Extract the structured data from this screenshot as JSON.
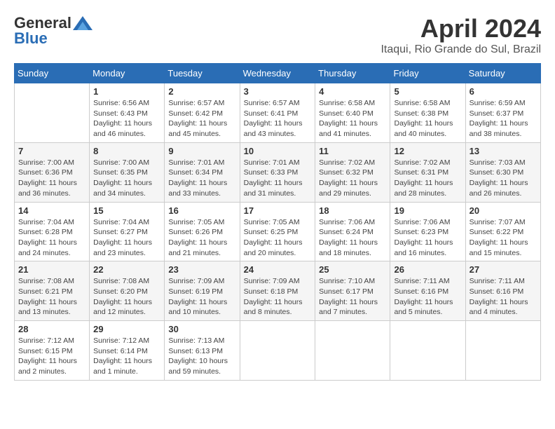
{
  "header": {
    "logo_general": "General",
    "logo_blue": "Blue",
    "month": "April 2024",
    "location": "Itaqui, Rio Grande do Sul, Brazil"
  },
  "weekdays": [
    "Sunday",
    "Monday",
    "Tuesday",
    "Wednesday",
    "Thursday",
    "Friday",
    "Saturday"
  ],
  "weeks": [
    [
      {
        "day": "",
        "sunrise": "",
        "sunset": "",
        "daylight": ""
      },
      {
        "day": "1",
        "sunrise": "Sunrise: 6:56 AM",
        "sunset": "Sunset: 6:43 PM",
        "daylight": "Daylight: 11 hours and 46 minutes."
      },
      {
        "day": "2",
        "sunrise": "Sunrise: 6:57 AM",
        "sunset": "Sunset: 6:42 PM",
        "daylight": "Daylight: 11 hours and 45 minutes."
      },
      {
        "day": "3",
        "sunrise": "Sunrise: 6:57 AM",
        "sunset": "Sunset: 6:41 PM",
        "daylight": "Daylight: 11 hours and 43 minutes."
      },
      {
        "day": "4",
        "sunrise": "Sunrise: 6:58 AM",
        "sunset": "Sunset: 6:40 PM",
        "daylight": "Daylight: 11 hours and 41 minutes."
      },
      {
        "day": "5",
        "sunrise": "Sunrise: 6:58 AM",
        "sunset": "Sunset: 6:38 PM",
        "daylight": "Daylight: 11 hours and 40 minutes."
      },
      {
        "day": "6",
        "sunrise": "Sunrise: 6:59 AM",
        "sunset": "Sunset: 6:37 PM",
        "daylight": "Daylight: 11 hours and 38 minutes."
      }
    ],
    [
      {
        "day": "7",
        "sunrise": "Sunrise: 7:00 AM",
        "sunset": "Sunset: 6:36 PM",
        "daylight": "Daylight: 11 hours and 36 minutes."
      },
      {
        "day": "8",
        "sunrise": "Sunrise: 7:00 AM",
        "sunset": "Sunset: 6:35 PM",
        "daylight": "Daylight: 11 hours and 34 minutes."
      },
      {
        "day": "9",
        "sunrise": "Sunrise: 7:01 AM",
        "sunset": "Sunset: 6:34 PM",
        "daylight": "Daylight: 11 hours and 33 minutes."
      },
      {
        "day": "10",
        "sunrise": "Sunrise: 7:01 AM",
        "sunset": "Sunset: 6:33 PM",
        "daylight": "Daylight: 11 hours and 31 minutes."
      },
      {
        "day": "11",
        "sunrise": "Sunrise: 7:02 AM",
        "sunset": "Sunset: 6:32 PM",
        "daylight": "Daylight: 11 hours and 29 minutes."
      },
      {
        "day": "12",
        "sunrise": "Sunrise: 7:02 AM",
        "sunset": "Sunset: 6:31 PM",
        "daylight": "Daylight: 11 hours and 28 minutes."
      },
      {
        "day": "13",
        "sunrise": "Sunrise: 7:03 AM",
        "sunset": "Sunset: 6:30 PM",
        "daylight": "Daylight: 11 hours and 26 minutes."
      }
    ],
    [
      {
        "day": "14",
        "sunrise": "Sunrise: 7:04 AM",
        "sunset": "Sunset: 6:28 PM",
        "daylight": "Daylight: 11 hours and 24 minutes."
      },
      {
        "day": "15",
        "sunrise": "Sunrise: 7:04 AM",
        "sunset": "Sunset: 6:27 PM",
        "daylight": "Daylight: 11 hours and 23 minutes."
      },
      {
        "day": "16",
        "sunrise": "Sunrise: 7:05 AM",
        "sunset": "Sunset: 6:26 PM",
        "daylight": "Daylight: 11 hours and 21 minutes."
      },
      {
        "day": "17",
        "sunrise": "Sunrise: 7:05 AM",
        "sunset": "Sunset: 6:25 PM",
        "daylight": "Daylight: 11 hours and 20 minutes."
      },
      {
        "day": "18",
        "sunrise": "Sunrise: 7:06 AM",
        "sunset": "Sunset: 6:24 PM",
        "daylight": "Daylight: 11 hours and 18 minutes."
      },
      {
        "day": "19",
        "sunrise": "Sunrise: 7:06 AM",
        "sunset": "Sunset: 6:23 PM",
        "daylight": "Daylight: 11 hours and 16 minutes."
      },
      {
        "day": "20",
        "sunrise": "Sunrise: 7:07 AM",
        "sunset": "Sunset: 6:22 PM",
        "daylight": "Daylight: 11 hours and 15 minutes."
      }
    ],
    [
      {
        "day": "21",
        "sunrise": "Sunrise: 7:08 AM",
        "sunset": "Sunset: 6:21 PM",
        "daylight": "Daylight: 11 hours and 13 minutes."
      },
      {
        "day": "22",
        "sunrise": "Sunrise: 7:08 AM",
        "sunset": "Sunset: 6:20 PM",
        "daylight": "Daylight: 11 hours and 12 minutes."
      },
      {
        "day": "23",
        "sunrise": "Sunrise: 7:09 AM",
        "sunset": "Sunset: 6:19 PM",
        "daylight": "Daylight: 11 hours and 10 minutes."
      },
      {
        "day": "24",
        "sunrise": "Sunrise: 7:09 AM",
        "sunset": "Sunset: 6:18 PM",
        "daylight": "Daylight: 11 hours and 8 minutes."
      },
      {
        "day": "25",
        "sunrise": "Sunrise: 7:10 AM",
        "sunset": "Sunset: 6:17 PM",
        "daylight": "Daylight: 11 hours and 7 minutes."
      },
      {
        "day": "26",
        "sunrise": "Sunrise: 7:11 AM",
        "sunset": "Sunset: 6:16 PM",
        "daylight": "Daylight: 11 hours and 5 minutes."
      },
      {
        "day": "27",
        "sunrise": "Sunrise: 7:11 AM",
        "sunset": "Sunset: 6:16 PM",
        "daylight": "Daylight: 11 hours and 4 minutes."
      }
    ],
    [
      {
        "day": "28",
        "sunrise": "Sunrise: 7:12 AM",
        "sunset": "Sunset: 6:15 PM",
        "daylight": "Daylight: 11 hours and 2 minutes."
      },
      {
        "day": "29",
        "sunrise": "Sunrise: 7:12 AM",
        "sunset": "Sunset: 6:14 PM",
        "daylight": "Daylight: 11 hours and 1 minute."
      },
      {
        "day": "30",
        "sunrise": "Sunrise: 7:13 AM",
        "sunset": "Sunset: 6:13 PM",
        "daylight": "Daylight: 10 hours and 59 minutes."
      },
      {
        "day": "",
        "sunrise": "",
        "sunset": "",
        "daylight": ""
      },
      {
        "day": "",
        "sunrise": "",
        "sunset": "",
        "daylight": ""
      },
      {
        "day": "",
        "sunrise": "",
        "sunset": "",
        "daylight": ""
      },
      {
        "day": "",
        "sunrise": "",
        "sunset": "",
        "daylight": ""
      }
    ]
  ]
}
